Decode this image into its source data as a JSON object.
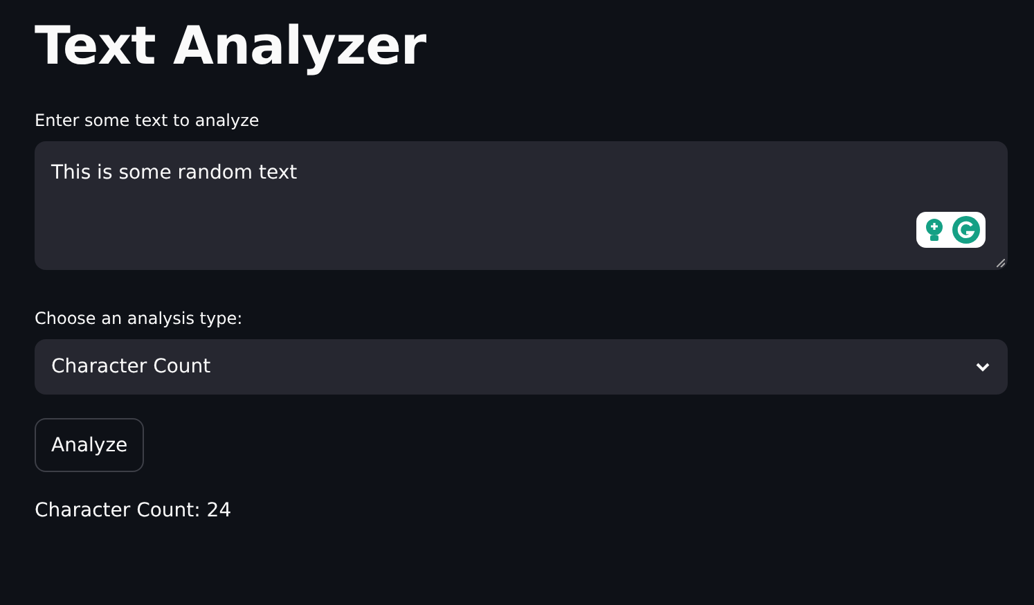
{
  "title": "Text Analyzer",
  "text_input": {
    "label": "Enter some text to analyze",
    "value": "This is some random text"
  },
  "analysis_select": {
    "label": "Choose an analysis type:",
    "value": "Character Count"
  },
  "analyze_button": {
    "label": "Analyze"
  },
  "result": "Character Count: 24"
}
